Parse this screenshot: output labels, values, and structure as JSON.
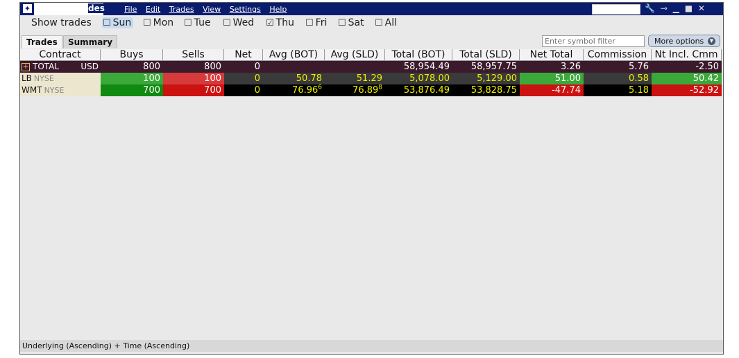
{
  "window": {
    "title": "des",
    "menu": [
      "File",
      "Edit",
      "Trades",
      "View",
      "Settings",
      "Help"
    ],
    "icons": [
      "app-icon",
      "wrench-icon",
      "pin-icon",
      "minimize-icon",
      "maximize-icon",
      "close-icon"
    ]
  },
  "show_trades": {
    "label": "Show trades",
    "days": [
      {
        "label": "Sun",
        "checked": false,
        "selected": true
      },
      {
        "label": "Mon",
        "checked": false,
        "selected": false
      },
      {
        "label": "Tue",
        "checked": false,
        "selected": false
      },
      {
        "label": "Wed",
        "checked": false,
        "selected": false
      },
      {
        "label": "Thu",
        "checked": true,
        "selected": false
      },
      {
        "label": "Fri",
        "checked": false,
        "selected": false
      },
      {
        "label": "Sat",
        "checked": false,
        "selected": false
      },
      {
        "label": "All",
        "checked": false,
        "selected": false
      }
    ]
  },
  "tabs": {
    "trades": "Trades",
    "summary": "Summary",
    "active": "Trades"
  },
  "filter": {
    "placeholder": "Enter symbol filter"
  },
  "more_options": {
    "label": "More options"
  },
  "table": {
    "columns": [
      "Contract",
      "Buys",
      "Sells",
      "Net",
      "Avg (BOT)",
      "Avg (SLD)",
      "Total (BOT)",
      "Total (SLD)",
      "Net Total",
      "Commission",
      "Nt Incl. Cmm"
    ],
    "total_row": {
      "contract": "TOTAL",
      "currency": "USD",
      "buys": "800",
      "sells": "800",
      "net": "0",
      "avg_bot": "",
      "avg_sld": "",
      "total_bot": "58,954.49",
      "total_sld": "58,957.75",
      "net_total": "3.26",
      "commission": "5.76",
      "nt_incl_cmm": "-2.50"
    },
    "rows": [
      {
        "contract": "LB",
        "exchange": "NYSE",
        "buys": "100",
        "sells": "100",
        "net": "0",
        "avg_bot": "50.78",
        "avg_bot_sup": "",
        "avg_sld": "51.29",
        "avg_sld_sup": "",
        "total_bot": "5,078.00",
        "total_sld": "5,129.00",
        "net_total": "51.00",
        "commission": "0.58",
        "nt_incl_cmm": "50.42"
      },
      {
        "contract": "WMT",
        "exchange": "NYSE",
        "buys": "700",
        "sells": "700",
        "net": "0",
        "avg_bot": "76.96",
        "avg_bot_sup": "6",
        "avg_sld": "76.89",
        "avg_sld_sup": "8",
        "total_bot": "53,876.49",
        "total_sld": "53,828.75",
        "net_total": "-47.74",
        "commission": "5.18",
        "nt_incl_cmm": "-52.92"
      }
    ]
  },
  "status_bar": {
    "text": "Underlying (Ascending)  +  Time (Ascending)"
  },
  "colors": {
    "title_bar": "#0a1c6e",
    "total_row_bg": "#3b1a2c",
    "buy_green": "#3aa93a",
    "buy_green_dark": "#118a11",
    "sell_red": "#d63a3a",
    "sell_red_dark": "#cc1111",
    "dark_cell": "#3a3a3a",
    "yellow_text": "#f0f000",
    "contract_bg": "#ece6cf"
  }
}
